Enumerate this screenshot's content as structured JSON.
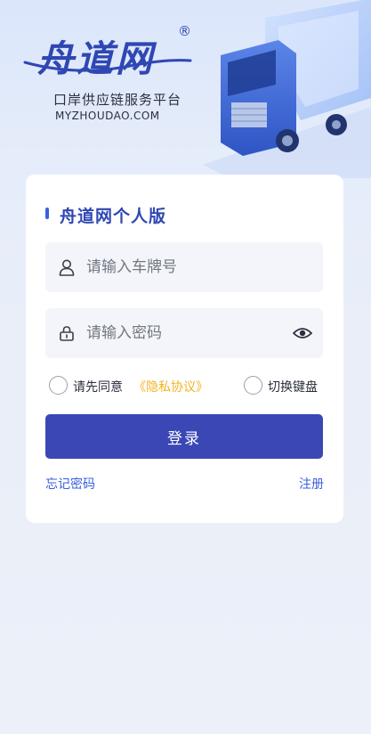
{
  "header": {
    "logo_text": "舟道网",
    "logo_mark": "®",
    "tagline": "口岸供应链服务平台",
    "site": "MYZHOUDAO.COM"
  },
  "card": {
    "title": "舟道网个人版",
    "plate_input": {
      "placeholder": "请输入车牌号",
      "value": ""
    },
    "password_input": {
      "placeholder": "请输入密码",
      "value": ""
    },
    "agree_label": "请先同意",
    "policy_link": "《隐私协议》",
    "keyboard_label": "切换键盘",
    "login_button": "登录",
    "forgot_link": "忘记密码",
    "register_link": "注册"
  },
  "icons": {
    "user": "user-icon",
    "lock": "lock-icon",
    "eye": "eye-icon"
  },
  "colors": {
    "brand": "#2f47b3",
    "accent": "#3a5fe0",
    "button": "#3a47b5",
    "policy": "#f3b324"
  }
}
